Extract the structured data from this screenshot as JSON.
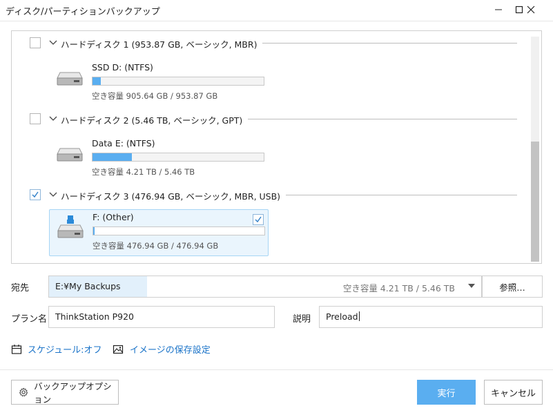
{
  "window": {
    "title": "ディスク/パーティションバックアップ",
    "minimize_icon": "minimize-icon",
    "maximize_icon": "maximize-icon",
    "close_icon": "close-icon"
  },
  "disks": [
    {
      "label": "ハードディスク 1 (953.87 GB, ベーシック, MBR)",
      "checked": false,
      "partition": {
        "name": "SSD D: (NTFS)",
        "usage_fraction": 0.05,
        "info": "空き容量 905.64 GB / 953.87 GB",
        "selected": false,
        "icon": "drive-icon"
      }
    },
    {
      "label": "ハードディスク 2 (5.46 TB, ベーシック, GPT)",
      "checked": false,
      "partition": {
        "name": "Data E: (NTFS)",
        "usage_fraction": 0.23,
        "info": "空き容量 4.21 TB / 5.46 TB",
        "selected": false,
        "icon": "drive-icon"
      }
    },
    {
      "label": "ハードディスク 3 (476.94 GB, ベーシック, MBR, USB)",
      "checked": true,
      "partition": {
        "name": "F: (Other)",
        "usage_fraction": 0.0,
        "info": "空き容量 476.94 GB / 476.94 GB",
        "selected": true,
        "icon": "usb-drive-icon"
      }
    }
  ],
  "destination": {
    "label": "宛先",
    "path": "E:¥My Backups",
    "free_space": "空き容量 4.21 TB / 5.46 TB",
    "browse_label": "参照…"
  },
  "plan": {
    "label": "プラン名",
    "value": "ThinkStation P920"
  },
  "description": {
    "label": "説明",
    "value": "Preload"
  },
  "links": {
    "schedule": "スケジュール:オフ",
    "image_settings": "イメージの保存設定"
  },
  "buttons": {
    "options": "バックアップオプション",
    "run": "実行",
    "cancel": "キャンセル"
  },
  "colors": {
    "accent": "#5aaef0",
    "link": "#1a73c8",
    "selection_bg": "#eaf5fd"
  }
}
